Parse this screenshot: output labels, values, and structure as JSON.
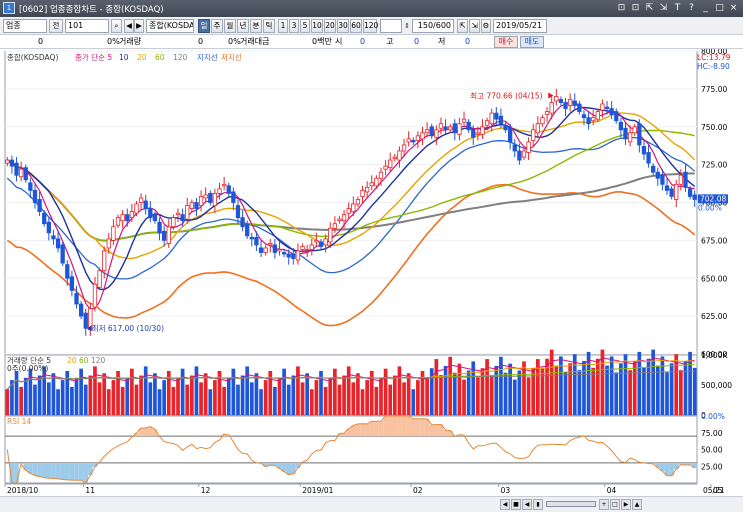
{
  "window": {
    "icon": "1",
    "title": "[0602] 업종종합차트 - 종합(KOSDAQ)",
    "controls": [
      "⊡",
      "⊡",
      "⇱",
      "⇲",
      "T",
      "?",
      "_",
      "□",
      "×"
    ]
  },
  "toolbar": {
    "market": "업종",
    "code_label": "전",
    "code": "101",
    "index_name": "종합(KOSDAQ)",
    "period_selected": "일",
    "periods": [
      "일",
      "주",
      "월",
      "년",
      "분",
      "틱"
    ],
    "minutes": [
      "1",
      "3",
      "5",
      "10",
      "20",
      "30",
      "60",
      "120"
    ],
    "count": "150/600",
    "date": "2019/05/21"
  },
  "quote": {
    "price": "0",
    "change": "0%",
    "volume_label": "거래량",
    "volume": "0",
    "volume_change": "0%",
    "amount_label": "거래대금",
    "amount": "0백만",
    "open_label": "시",
    "open": "0",
    "high_label": "고",
    "high": "0",
    "low_label": "저",
    "low": "0",
    "buy_label": "매수",
    "sell_label": "매도"
  },
  "chart_data": [
    {
      "type": "candlestick",
      "panel": "price",
      "title": "종합(KOSDAQ)",
      "legend": [
        {
          "name": "종가 단순 5",
          "color": "#d4147a"
        },
        {
          "name": "10",
          "color": "#1e2fa0"
        },
        {
          "name": "20",
          "color": "#e9a300"
        },
        {
          "name": "60",
          "color": "#8cb800"
        },
        {
          "name": "120",
          "color": "#7f7f7f"
        },
        {
          "name": "지지선",
          "color": "#2f66d0"
        },
        {
          "name": "저지선",
          "color": "#f07020"
        }
      ],
      "ylim": [
        600,
        800
      ],
      "y_ticks": [
        "800.00",
        "775.00",
        "750.00",
        "725.00",
        "700.00",
        "675.00",
        "650.00",
        "625.00",
        "600.00"
      ],
      "x_ticks": [
        "2018/10",
        "11",
        "12",
        "2019/01",
        "02",
        "03",
        "04",
        "05",
        "05/21"
      ],
      "annotations": [
        {
          "text": "최고 770.66 (04/15)",
          "value": 770.66
        },
        {
          "text": "최저 617.00 (10/30)",
          "value": 617.0
        }
      ],
      "right_labels": {
        "lc": "LC:13.79",
        "hc": "HC:-8.90",
        "last": "702.08",
        "last_pct": "0.00%"
      },
      "close": [
        728,
        724,
        718,
        722,
        715,
        708,
        700,
        694,
        686,
        680,
        676,
        670,
        660,
        650,
        642,
        633,
        625,
        617,
        630,
        646,
        655,
        668,
        676,
        684,
        690,
        692,
        688,
        694,
        699,
        703,
        696,
        690,
        688,
        680,
        675,
        684,
        690,
        693,
        688,
        698,
        700,
        696,
        704,
        705,
        700,
        706,
        709,
        712,
        706,
        700,
        690,
        684,
        678,
        676,
        672,
        667,
        670,
        673,
        667,
        669,
        666,
        664,
        663,
        668,
        671,
        669,
        672,
        675,
        671,
        676,
        683,
        686,
        689,
        692,
        696,
        699,
        702,
        708,
        710,
        713,
        716,
        720,
        724,
        728,
        730,
        734,
        738,
        742,
        740,
        744,
        746,
        748,
        744,
        748,
        752,
        748,
        750,
        746,
        752,
        755,
        748,
        743,
        746,
        750,
        754,
        759,
        755,
        752,
        748,
        740,
        734,
        728,
        734,
        740,
        748,
        752,
        756,
        760,
        766,
        770,
        766,
        762,
        768,
        764,
        760,
        756,
        752,
        756,
        760,
        765,
        762,
        758,
        754,
        748,
        742,
        746,
        750,
        738,
        732,
        726,
        720,
        716,
        712,
        708,
        704,
        712,
        718,
        710,
        704,
        702
      ],
      "support_resistance": {
        "support_last": 702.08,
        "resistance_min": 620,
        "resistance_max": 685
      }
    },
    {
      "type": "bar",
      "panel": "volume",
      "title": "거래량 단순 5 20 60 120",
      "legend": [
        {
          "name": "거래량 단순 5",
          "color": "#d4147a"
        },
        {
          "name": "20",
          "color": "#e9a300"
        },
        {
          "name": "60",
          "color": "#8cb800"
        },
        {
          "name": "120",
          "color": "#7f7f7f"
        }
      ],
      "note": "0주(0.00%)",
      "y_ticks": [
        "1,000K",
        "500,000",
        "0",
        "0.00%"
      ],
      "ylim": [
        0,
        1000000
      ]
    },
    {
      "type": "line",
      "panel": "rsi",
      "title": "RSI 14",
      "legend": [
        {
          "name": "RSI 14",
          "color": "#e58a3a"
        }
      ],
      "y_ticks": [
        "75.00",
        "50.00",
        "25.00"
      ],
      "ylim": [
        0,
        100
      ],
      "hlines": [
        70,
        30
      ]
    }
  ]
}
